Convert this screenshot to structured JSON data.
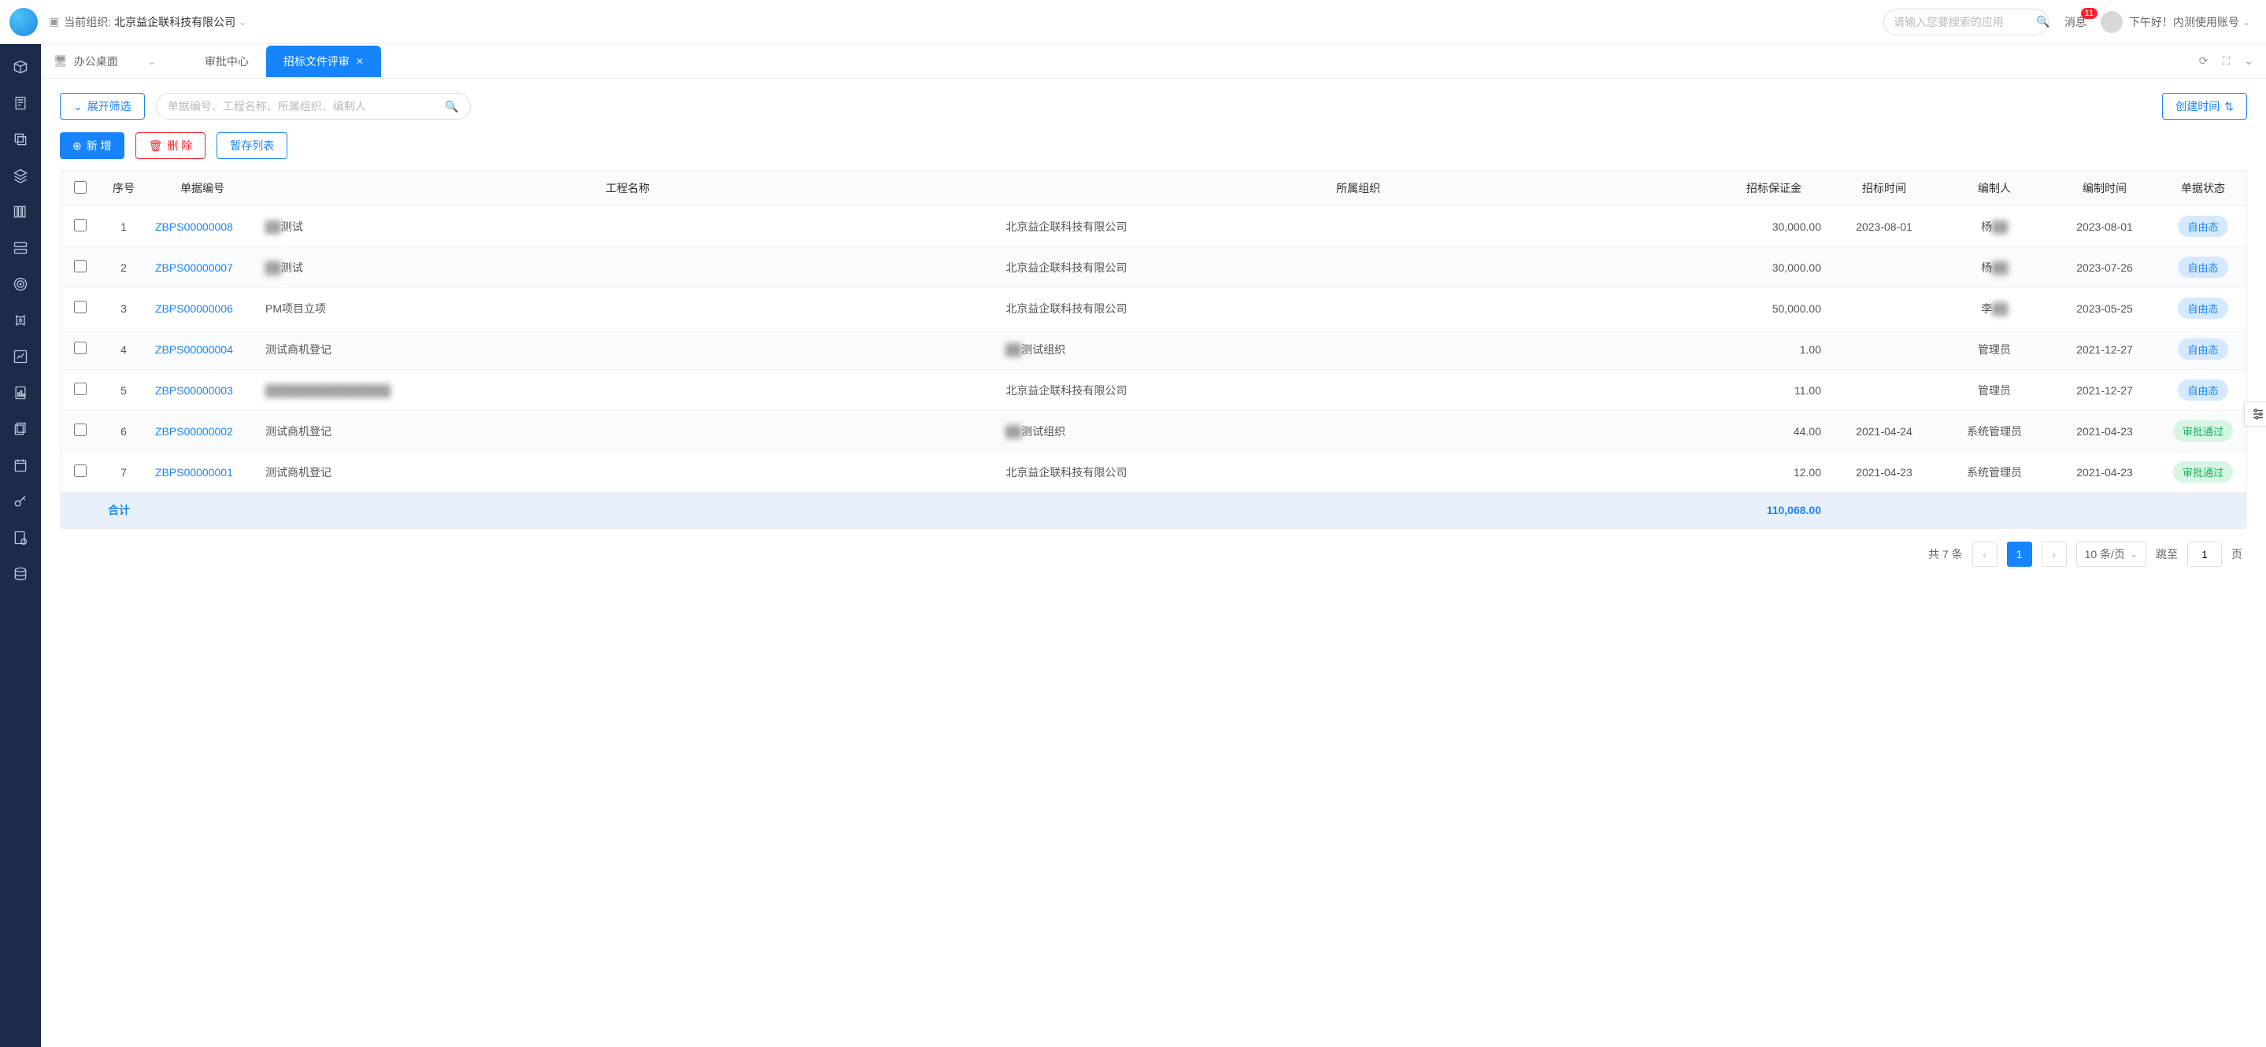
{
  "header": {
    "org_label": "当前组织:",
    "org_name": "北京益企联科技有限公司",
    "search_placeholder": "请输入您要搜索的应用",
    "messages_label": "消息",
    "messages_count": "11",
    "greeting": "下午好！内测使用账号"
  },
  "tabs": {
    "workspace": "办公桌面",
    "items": [
      "审批中心",
      "招标文件评审"
    ],
    "active_index": 1
  },
  "toolbar": {
    "expand_filter": "展开筛选",
    "filter_placeholder": "单据编号、工程名称、所属组织、编制人",
    "sort_label": "创建时间",
    "add": "新 增",
    "delete": "删 除",
    "draft_list": "暂存列表"
  },
  "table": {
    "headers": {
      "seq": "序号",
      "id": "单据编号",
      "project": "工程名称",
      "org": "所属组织",
      "deposit": "招标保证金",
      "bid_date": "招标时间",
      "author": "编制人",
      "create_date": "编制时间",
      "status": "单据状态"
    },
    "rows": [
      {
        "seq": "1",
        "id": "ZBPS00000008",
        "project_blur": "██",
        "project": "测试",
        "org": "北京益企联科技有限公司",
        "deposit": "30,000.00",
        "bid_date": "2023-08-01",
        "author_pre": "杨",
        "author_blur": "██",
        "create_date": "2023-08-01",
        "status": "自由态",
        "status_type": "free"
      },
      {
        "seq": "2",
        "id": "ZBPS00000007",
        "project_blur": "██",
        "project": "测试",
        "org": "北京益企联科技有限公司",
        "deposit": "30,000.00",
        "bid_date": "",
        "author_pre": "杨",
        "author_blur": "██",
        "create_date": "2023-07-26",
        "status": "自由态",
        "status_type": "free"
      },
      {
        "seq": "3",
        "id": "ZBPS00000006",
        "project_blur": "",
        "project": "PM项目立项",
        "org": "北京益企联科技有限公司",
        "deposit": "50,000.00",
        "bid_date": "",
        "author_pre": "李",
        "author_blur": "██",
        "create_date": "2023-05-25",
        "status": "自由态",
        "status_type": "free"
      },
      {
        "seq": "4",
        "id": "ZBPS00000004",
        "project_blur": "",
        "project": "测试商机登记",
        "org_blur": "██",
        "org": "测试组织",
        "deposit": "1.00",
        "bid_date": "",
        "author_pre": "管理员",
        "author_blur": "",
        "create_date": "2021-12-27",
        "status": "自由态",
        "status_type": "free"
      },
      {
        "seq": "5",
        "id": "ZBPS00000003",
        "project_blur": "████████████████",
        "project": "",
        "org": "北京益企联科技有限公司",
        "deposit": "11.00",
        "bid_date": "",
        "author_pre": "管理员",
        "author_blur": "",
        "create_date": "2021-12-27",
        "status": "自由态",
        "status_type": "free"
      },
      {
        "seq": "6",
        "id": "ZBPS00000002",
        "project_blur": "",
        "project": "测试商机登记",
        "org_blur": "██",
        "org": "测试组织",
        "deposit": "44.00",
        "bid_date": "2021-04-24",
        "author_pre": "系统管理员",
        "author_blur": "",
        "create_date": "2021-04-23",
        "status": "审批通过",
        "status_type": "pass"
      },
      {
        "seq": "7",
        "id": "ZBPS00000001",
        "project_blur": "",
        "project": "测试商机登记",
        "org": "北京益企联科技有限公司",
        "deposit": "12.00",
        "bid_date": "2021-04-23",
        "author_pre": "系统管理员",
        "author_blur": "",
        "create_date": "2021-04-23",
        "status": "审批通过",
        "status_type": "pass"
      }
    ],
    "total_label": "合计",
    "total_deposit": "110,068.00"
  },
  "pagination": {
    "total_text": "共 7 条",
    "current": "1",
    "page_size_label": "10 条/页",
    "jump_label": "跳至",
    "jump_value": "1",
    "page_suffix": "页"
  }
}
